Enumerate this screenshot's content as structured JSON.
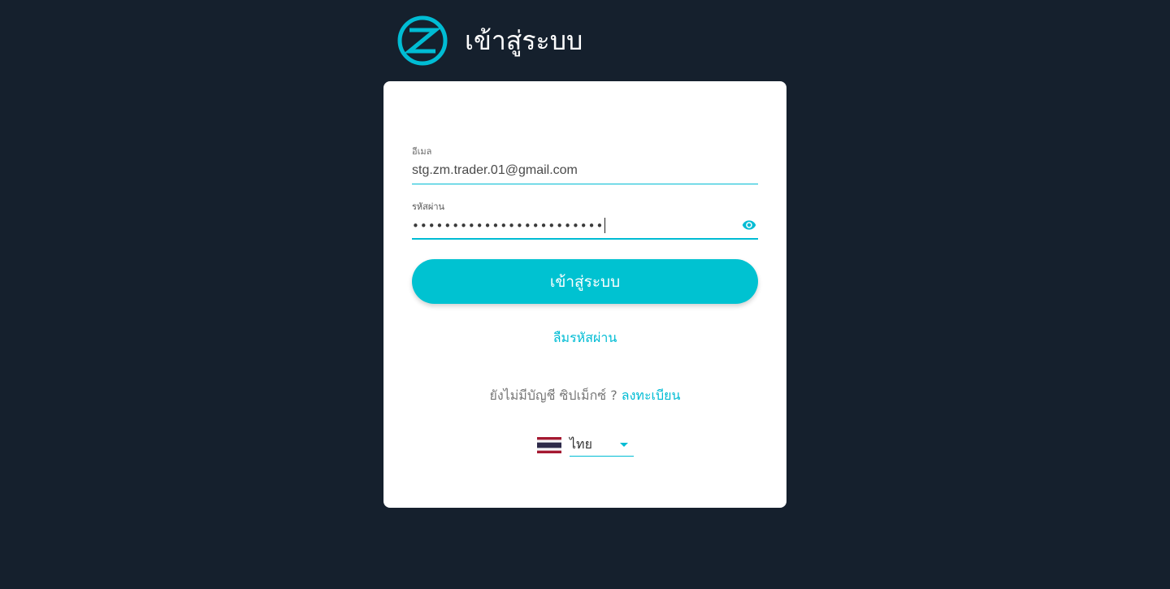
{
  "header": {
    "title": "เข้าสู่ระบบ",
    "logo_icon": "zipmex-logo-icon"
  },
  "form": {
    "email": {
      "label": "อีเมล",
      "value": "stg.zm.trader.01@gmail.com"
    },
    "password": {
      "label": "รหัสผ่าน",
      "masked_value": "••••••••••••••••••••••••",
      "toggle_icon": "eye-icon"
    },
    "submit_label": "เข้าสู่ระบบ",
    "forgot_password": "ลืมรหัสผ่าน",
    "register_prompt": "ยังไม่มีบัญชี ซิปเม็กซ์ ?",
    "register_link": "ลงทะเบียน"
  },
  "language": {
    "selected": "ไทย",
    "flag_icon": "thailand-flag-icon"
  },
  "colors": {
    "background": "#15202d",
    "accent": "#00c2d1",
    "card": "#ffffff"
  }
}
